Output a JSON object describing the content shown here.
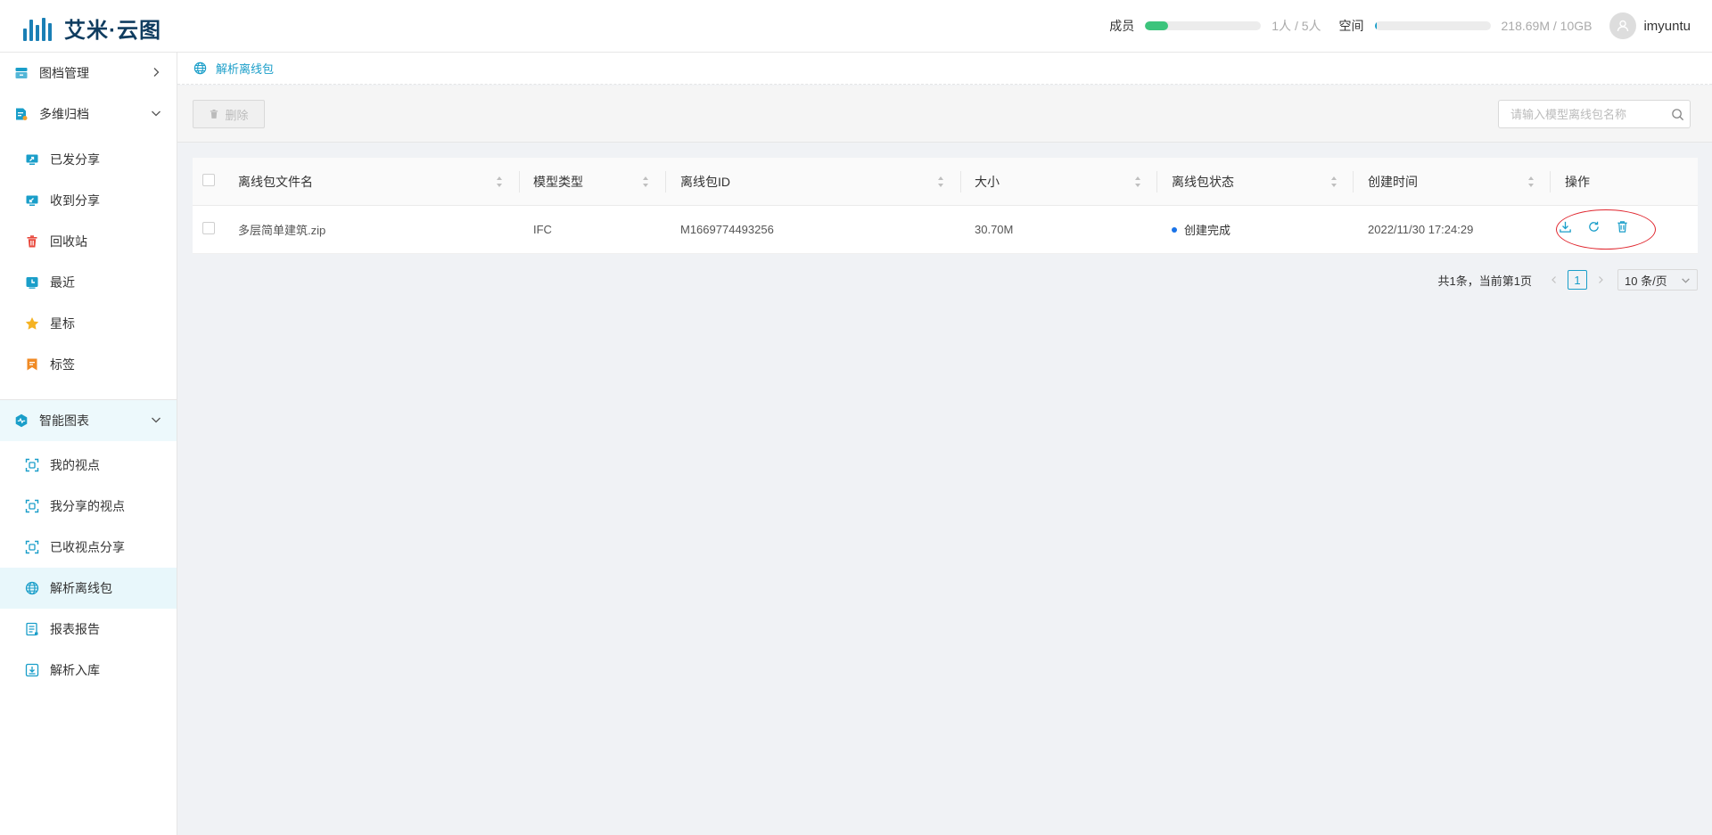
{
  "app": {
    "title": "艾米·云图",
    "accent": "#1a9ec9"
  },
  "header": {
    "members_label": "成员",
    "members_value": "1人 / 5人",
    "members_fraction": 0.2,
    "members_color": "#3cc47c",
    "space_label": "空间",
    "space_value": "218.69M / 10GB",
    "space_fraction": 0.021,
    "space_color": "#1a9ec9",
    "username": "imyuntu"
  },
  "sidebar": {
    "groups": [
      {
        "label": "图档管理",
        "icon": "archive-icon"
      },
      {
        "label": "多维归档",
        "icon": "file-archive-icon"
      },
      {
        "label": "智能图表",
        "icon": "chart-pulse-icon"
      }
    ],
    "items": [
      {
        "label": "已发分享",
        "icon": "share-out-icon"
      },
      {
        "label": "收到分享",
        "icon": "share-in-icon"
      },
      {
        "label": "回收站",
        "icon": "trash-icon"
      },
      {
        "label": "最近",
        "icon": "clock-icon"
      },
      {
        "label": "星标",
        "icon": "star-icon"
      },
      {
        "label": "标签",
        "icon": "bookmark-icon"
      },
      {
        "label": "我的视点",
        "icon": "viewpoint-icon"
      },
      {
        "label": "我分享的视点",
        "icon": "viewpoint-share-icon"
      },
      {
        "label": "已收视点分享",
        "icon": "viewpoint-received-icon"
      },
      {
        "label": "解析离线包",
        "icon": "globe-icon"
      },
      {
        "label": "报表报告",
        "icon": "report-icon"
      },
      {
        "label": "解析入库",
        "icon": "import-icon"
      }
    ]
  },
  "breadcrumb": {
    "current": "解析离线包"
  },
  "toolbar": {
    "delete_label": "删除",
    "search_placeholder": "请输入模型离线包名称"
  },
  "table": {
    "columns": [
      "离线包文件名",
      "模型类型",
      "离线包ID",
      "大小",
      "离线包状态",
      "创建时间",
      "操作"
    ],
    "rows": [
      {
        "file_name": "多层简单建筑.zip",
        "model_type": "IFC",
        "package_id": "M1669774493256",
        "size": "30.70M",
        "status": "创建完成",
        "created_at": "2022/11/30 17:24:29"
      }
    ]
  },
  "pagination": {
    "summary": "共1条，当前第1页",
    "current_page": "1",
    "page_size": "10 条/页"
  }
}
